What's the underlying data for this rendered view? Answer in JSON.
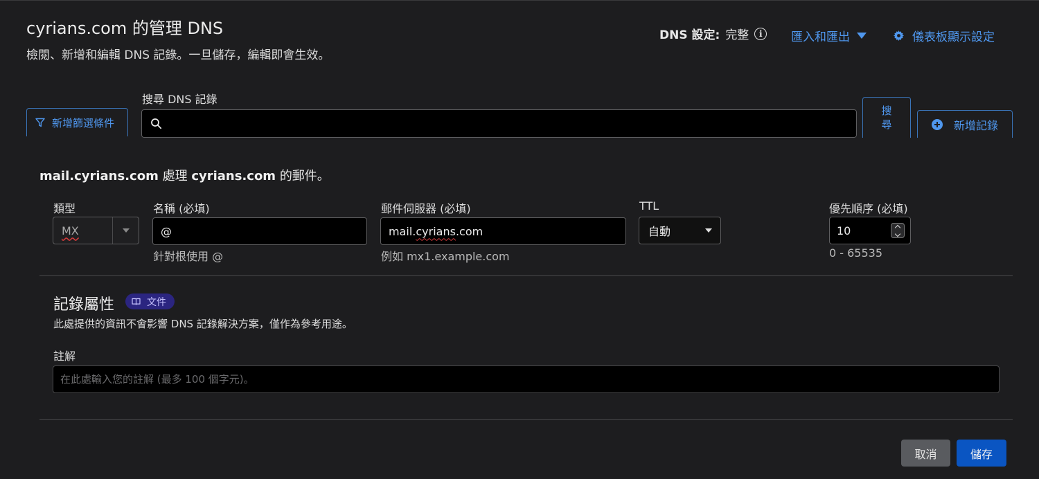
{
  "header": {
    "title": "cyrians.com 的管理 DNS",
    "subtitle": "檢閱、新增和編輯 DNS 記錄。一旦儲存，編輯即會生效。",
    "dns_status_label": "DNS 設定:",
    "dns_status_value": "完整",
    "import_export_label": "匯入和匯出",
    "dashboard_settings_label": "儀表板顯示設定"
  },
  "toolbar": {
    "filter_label": "新增篩選條件",
    "search_label": "搜尋 DNS 記錄",
    "search_value": "",
    "search_button_line1": "搜",
    "search_button_line2": "尋",
    "add_record_label": "新增記錄"
  },
  "mail_note": {
    "host": "mail.cyrians.com",
    "middle": "處理",
    "domain": "cyrians.com",
    "suffix": "的郵件。"
  },
  "record_form": {
    "type_label": "類型",
    "type_value": "MX",
    "name_label": "名稱 (必填)",
    "name_value": "@",
    "name_hint": "針對根使用 @",
    "mail_server_label": "郵件伺服器 (必填)",
    "mail_server_prefix": "mail.",
    "mail_server_mid": "cyrians",
    "mail_server_suffix": ".com",
    "mail_server_hint": "例如 mx1.example.com",
    "ttl_label": "TTL",
    "ttl_value": "自動",
    "priority_label": "優先順序 (必填)",
    "priority_value": "10",
    "priority_hint": "0 - 65535"
  },
  "attributes": {
    "title": "記錄屬性",
    "doc_badge": "文件",
    "description": "此處提供的資訊不會影響 DNS 記錄解決方案，僅作為參考用途。",
    "comment_label": "註解",
    "comment_placeholder": "在此處輸入您的註解 (最多 100 個字元)。"
  },
  "footer": {
    "cancel_label": "取消",
    "save_label": "儲存"
  },
  "colors": {
    "accent": "#4f97ee",
    "save_button": "#0a55c2",
    "cancel_button": "#595b5f",
    "badge_bg": "#2b2580"
  }
}
